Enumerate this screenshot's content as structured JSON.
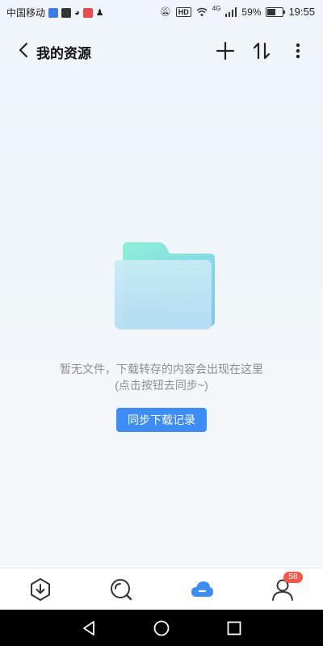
{
  "status_bar": {
    "carrier": "中国移动",
    "battery_percent": "59%",
    "battery_level": 0.59,
    "hd_label": "HD",
    "network_label": "4G",
    "time": "19:55"
  },
  "header": {
    "title": "我的资源",
    "icons": [
      "back-icon",
      "plus-icon",
      "sort-icon",
      "more-icon"
    ]
  },
  "empty_state": {
    "line1": "暂无文件，下载转存的内容会出现在这里",
    "line2": "(点击按钮去同步~)",
    "button_label": "同步下载记录"
  },
  "bottom_nav": {
    "items": [
      "download-icon",
      "discover-icon",
      "cloud-icon",
      "profile-icon"
    ],
    "active_index": 2,
    "profile_badge": "58"
  },
  "colors": {
    "accent": "#3d8df5",
    "badge": "#f2574a",
    "folder_front": "#bfe6f5",
    "folder_back": "#7fe0cf"
  }
}
